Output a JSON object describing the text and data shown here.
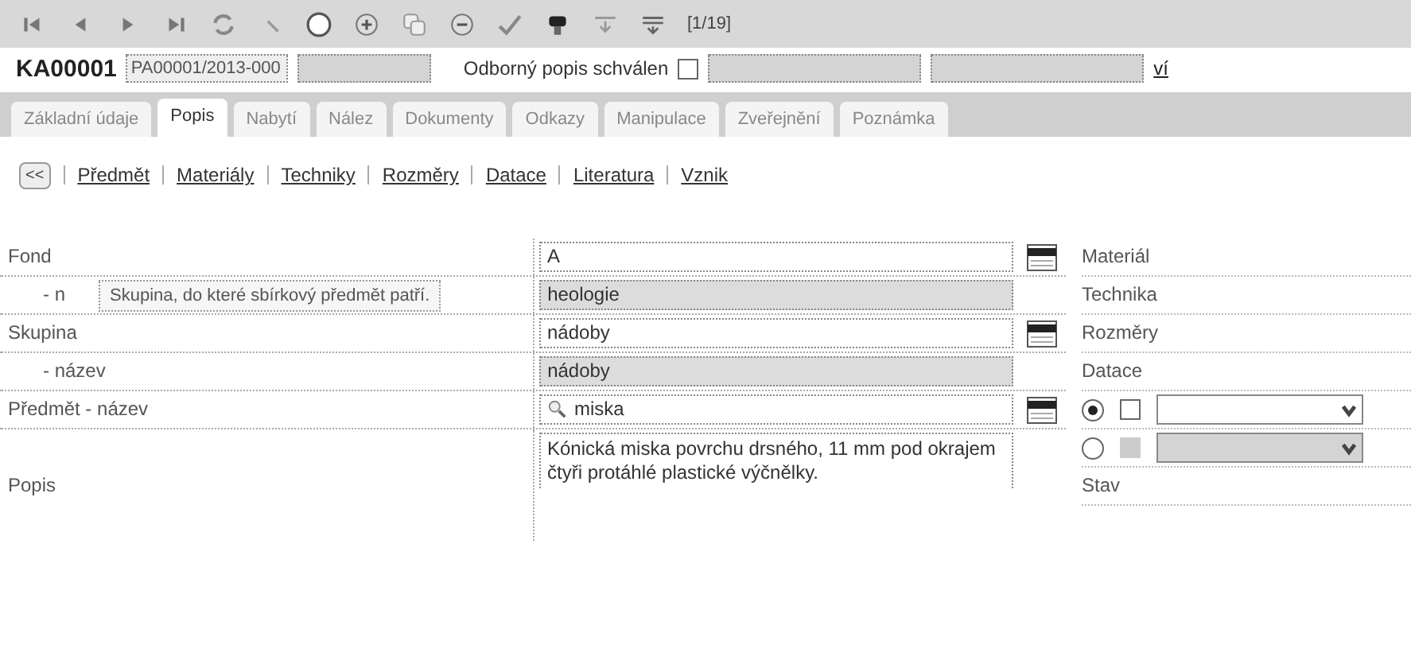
{
  "toolbar": {
    "record_counter": "[1/19]"
  },
  "header": {
    "code": "KA00001",
    "inventory_value": "PA00001/2013-000",
    "approved_label": "Odborný popis schválen",
    "approved_checked": false,
    "link": "ví"
  },
  "tabs": [
    {
      "label": "Základní údaje",
      "selected": false
    },
    {
      "label": "Popis",
      "selected": true
    },
    {
      "label": "Nabytí",
      "selected": false
    },
    {
      "label": "Nález",
      "selected": false
    },
    {
      "label": "Dokumenty",
      "selected": false
    },
    {
      "label": "Odkazy",
      "selected": false
    },
    {
      "label": "Manipulace",
      "selected": false
    },
    {
      "label": "Zveřejnění",
      "selected": false
    },
    {
      "label": "Poznámka",
      "selected": false
    }
  ],
  "section_nav": {
    "back": "<<",
    "links": [
      "Předmět",
      "Materiály",
      "Techniky",
      "Rozměry",
      "Datace",
      "Literatura",
      "Vznik"
    ]
  },
  "form": [
    {
      "label": "Fond",
      "value": "A",
      "kind": "picker"
    },
    {
      "label": "- n",
      "value": "heologie",
      "kind": "readonly"
    },
    {
      "label": "Skupina",
      "value": "nádoby",
      "kind": "picker"
    },
    {
      "label": "- název",
      "value": "nádoby",
      "kind": "readonly"
    },
    {
      "label": "Předmět - název",
      "value": "miska",
      "kind": "search"
    },
    {
      "label": "Popis",
      "value": "Kónická miska povrchu drsného, 11 mm pod okrajem čtyři protáhlé plastické výčnělky.",
      "kind": "textarea"
    }
  ],
  "tooltip": "Skupina, do které sbírkový předmět patří.",
  "right_panel": {
    "labels_top": [
      "Materiál",
      "Technika",
      "Rozměry",
      "Datace"
    ],
    "datace_rows": [
      {
        "selected": true,
        "checked": false,
        "disabled": false
      },
      {
        "selected": false,
        "checked": false,
        "disabled": true
      }
    ],
    "labels_bottom": [
      "Stav"
    ]
  }
}
